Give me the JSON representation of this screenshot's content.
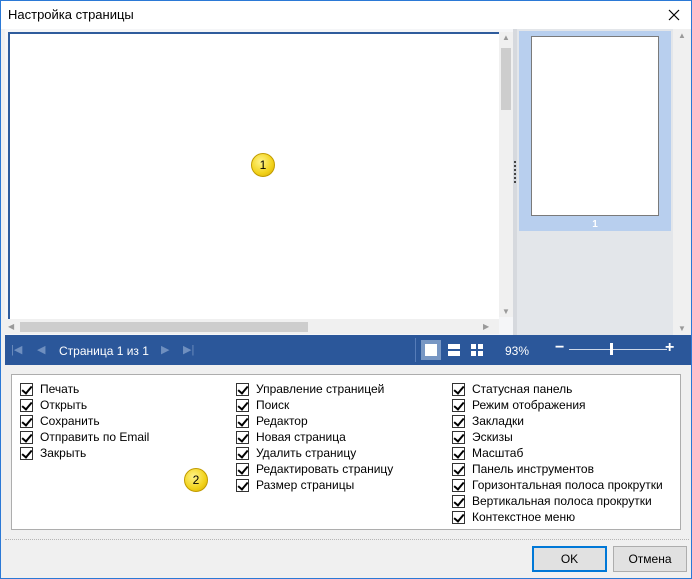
{
  "window": {
    "title": "Настройка страницы"
  },
  "viewer": {
    "thumbnail_label": "1",
    "marker_1": "1"
  },
  "toolbar": {
    "page_status": "Страница 1 из 1",
    "zoom": "93%"
  },
  "options": {
    "marker_2": "2",
    "col1": [
      "Печать",
      "Открыть",
      "Сохранить",
      "Отправить по Email",
      "Закрыть"
    ],
    "col2": [
      "Управление страницей",
      "Поиск",
      "Редактор",
      "Новая страница",
      "Удалить страницу",
      "Редактировать страницу",
      "Размер страницы"
    ],
    "col3": [
      "Статусная панель",
      "Режим отображения",
      "Закладки",
      "Эскизы",
      "Масштаб",
      "Панель инструментов",
      "Горизонтальная полоса прокрутки",
      "Вертикальная полоса прокрутки",
      "Контекстное меню"
    ]
  },
  "buttons": {
    "ok": "OK",
    "cancel": "Отмена"
  },
  "colors": {
    "toolbar": "#2b579a",
    "accent": "#0078d7",
    "thumbnail_selection": "#b8cfee"
  }
}
